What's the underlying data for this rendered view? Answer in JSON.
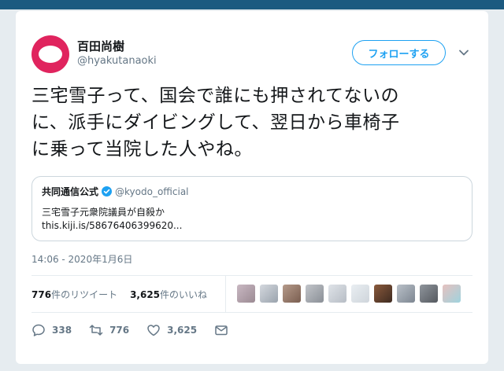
{
  "user": {
    "display_name": "百田尚樹",
    "handle": "@hyakutanaoki"
  },
  "follow_button_label": "フォローする",
  "tweet": {
    "lines": [
      "三宅雪子って、国会で誰にも押されてないの",
      "に、派手にダイビングして、翌日から車椅子",
      "に乗って当院した人やね。"
    ]
  },
  "quote": {
    "name": "共同通信公式",
    "handle": "@kyodo_official",
    "text": "三宅雪子元衆院議員が自殺か",
    "link": "this.kiji.is/58676406399620..."
  },
  "timestamp": "14:06 - 2020年1月6日",
  "stats": {
    "retweet_count": "776",
    "retweet_label": "件のリツイート",
    "like_count": "3,625",
    "like_label": "件のいいね"
  },
  "actions": {
    "reply_count": "338",
    "retweet_count": "776",
    "like_count": "3,625"
  },
  "colors": {
    "accent": "#1da1f2",
    "avatar": "#e0245e",
    "top_bar": "#1c5a80",
    "background": "#e6ecf0"
  },
  "icons": [
    "chevron-down-icon",
    "verified-icon",
    "reply-icon",
    "retweet-icon",
    "like-icon",
    "message-icon"
  ]
}
